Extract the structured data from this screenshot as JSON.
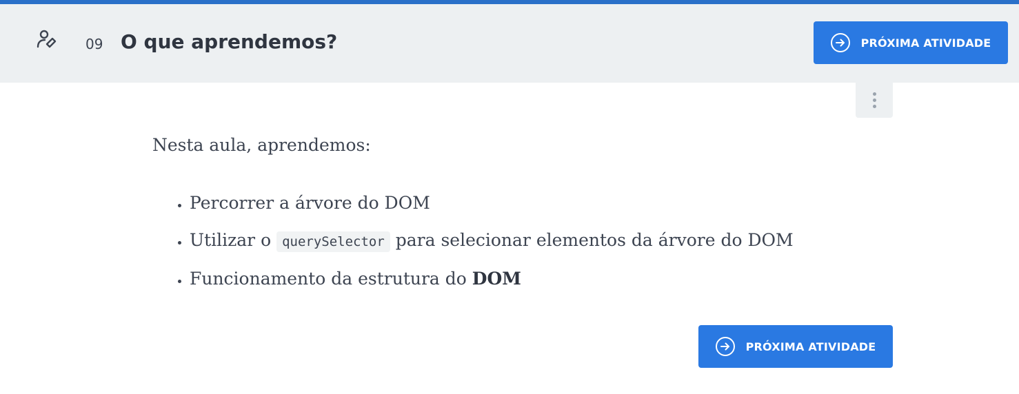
{
  "header": {
    "task_number": "09",
    "task_title": "O que aprendemos?",
    "task_icon": "user-edit-icon",
    "next_button_label": "PRÓXIMA ATIVIDADE"
  },
  "content": {
    "intro": "Nesta aula, aprendemos:",
    "items": [
      {
        "text": "Percorrer a árvore do DOM"
      },
      {
        "before": "Utilizar o ",
        "code": "querySelector",
        "after": " para selecionar elementos da árvore do DOM"
      },
      {
        "before": "Funcionamento da estrutura do ",
        "bold": "DOM"
      }
    ]
  },
  "footer": {
    "next_button_label": "PRÓXIMA ATIVIDADE"
  },
  "colors": {
    "accent": "#2a79e2",
    "header_bg": "#edf0f2",
    "top_line": "#2a70c9"
  }
}
